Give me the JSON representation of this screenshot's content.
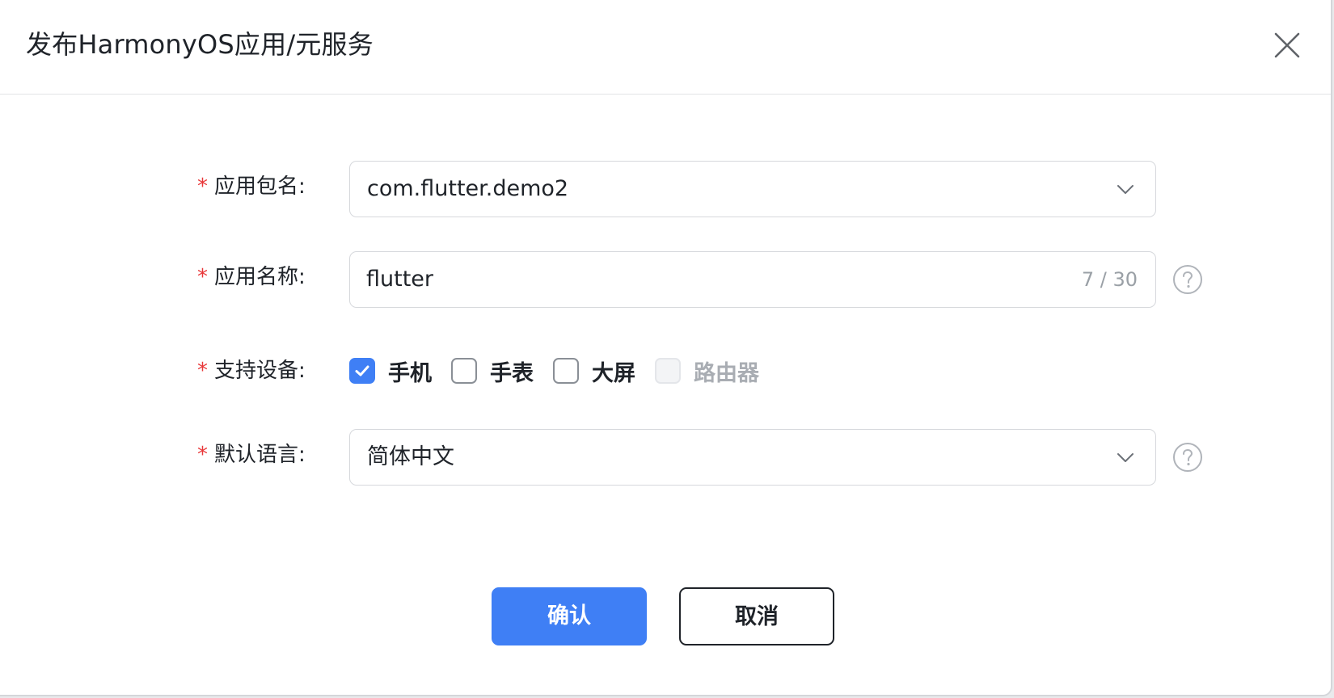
{
  "dialog": {
    "title": "发布HarmonyOS应用/元服务",
    "close_icon": "close-icon"
  },
  "form": {
    "required_mark": "*",
    "package": {
      "label": "应用包名:",
      "value": "com.flutter.demo2",
      "icon": "chevron-down-icon"
    },
    "app_name": {
      "label": "应用名称:",
      "value": "flutter",
      "counter": "7 / 30",
      "help_icon": "question-circle-icon"
    },
    "devices": {
      "label": "支持设备:",
      "options": [
        {
          "label": "手机",
          "checked": true,
          "disabled": false
        },
        {
          "label": "手表",
          "checked": false,
          "disabled": false
        },
        {
          "label": "大屏",
          "checked": false,
          "disabled": false
        },
        {
          "label": "路由器",
          "checked": false,
          "disabled": true
        }
      ]
    },
    "language": {
      "label": "默认语言:",
      "value": "简体中文",
      "icon": "chevron-down-icon",
      "help_icon": "question-circle-icon"
    }
  },
  "buttons": {
    "confirm": "确认",
    "cancel": "取消"
  },
  "colors": {
    "primary": "#3f7ff5",
    "required": "#e8393a",
    "border": "#d6d8dc",
    "text": "#1f2329",
    "muted": "#9aa0a6"
  }
}
